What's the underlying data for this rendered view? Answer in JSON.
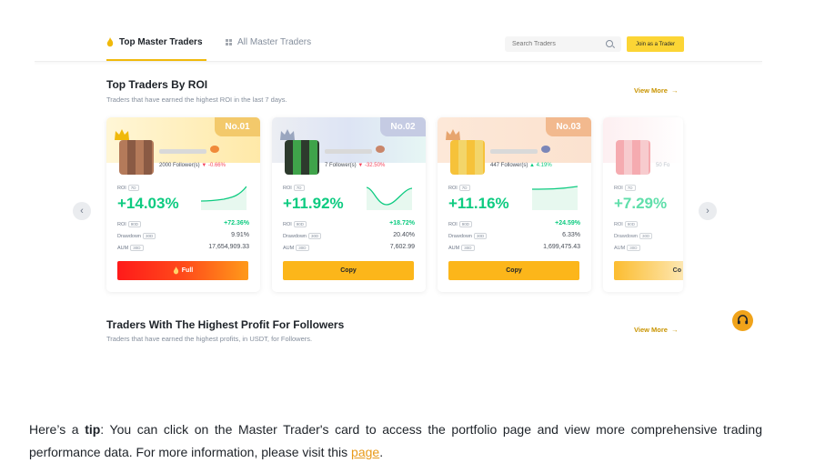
{
  "topbar": {
    "tab_active": "Top Master Traders",
    "tab_all": "All Master Traders",
    "search_placeholder": "Search Traders",
    "join_button": "Join as a Trader"
  },
  "section1": {
    "title": "Top Traders By ROI",
    "subtitle": "Traders that have earned the highest ROI in the last 7 days.",
    "view_more": "View More",
    "arrow": "→"
  },
  "section2": {
    "title": "Traders With The Highest Profit For Followers",
    "subtitle": "Traders that have earned the highest profits, in USDT, for Followers.",
    "view_more": "View More",
    "arrow": "→"
  },
  "nav": {
    "left": "‹",
    "right": "›"
  },
  "cards": [
    {
      "rank": "No.01",
      "followers": "2000 Follower(s)",
      "delta": "▼ -0.66%",
      "roi_label": "ROI",
      "roi_tag": "7D",
      "roi_value": "+14.03%",
      "roi_row_label": "ROI",
      "roi_row_tag": "90D",
      "roi_row_value": "+72.36%",
      "drawdown_label": "Drawdown",
      "drawdown_tag": "30D",
      "drawdown_value": "9.91%",
      "aum_label": "AUM",
      "aum_tag": "30D",
      "aum_value": "17,654,909.33",
      "button": "Full",
      "button_icon": "flame-icon"
    },
    {
      "rank": "No.02",
      "followers": "7 Follower(s)",
      "delta": "▼ -32.50%",
      "roi_label": "ROI",
      "roi_tag": "7D",
      "roi_value": "+11.92%",
      "roi_row_label": "ROI",
      "roi_row_tag": "90D",
      "roi_row_value": "+18.72%",
      "drawdown_label": "Drawdown",
      "drawdown_tag": "30D",
      "drawdown_value": "20.40%",
      "aum_label": "AUM",
      "aum_tag": "30D",
      "aum_value": "7,602.99",
      "button": "Copy"
    },
    {
      "rank": "No.03",
      "followers": "447 Follower(s)",
      "delta": "▲ 4.19%",
      "roi_label": "ROI",
      "roi_tag": "7D",
      "roi_value": "+11.16%",
      "roi_row_label": "ROI",
      "roi_row_tag": "90D",
      "roi_row_value": "+24.59%",
      "drawdown_label": "Drawdown",
      "drawdown_tag": "30D",
      "drawdown_value": "6.33%",
      "aum_label": "AUM",
      "aum_tag": "30D",
      "aum_value": "1,699,475.43",
      "button": "Copy"
    },
    {
      "followers": "50 Fo",
      "roi_label": "ROI",
      "roi_tag": "7D",
      "roi_value": "+7.29%",
      "roi_row_label": "ROI",
      "roi_row_tag": "90D",
      "drawdown_label": "Drawdown",
      "drawdown_tag": "30D",
      "aum_label": "AUM",
      "aum_tag": "30D",
      "button": "Co"
    }
  ],
  "tip": {
    "prefix": "Here’s a ",
    "bold": "tip",
    "body": ": You can click on the Master Trader's card to access the portfolio page and view more comprehensive trading performance data. For more information, please visit this ",
    "link": "page",
    "suffix": "."
  },
  "colors": {
    "accent": "#fcd535",
    "positive": "#0ecb81",
    "negative": "#f6465d",
    "link": "#e89a1a"
  }
}
